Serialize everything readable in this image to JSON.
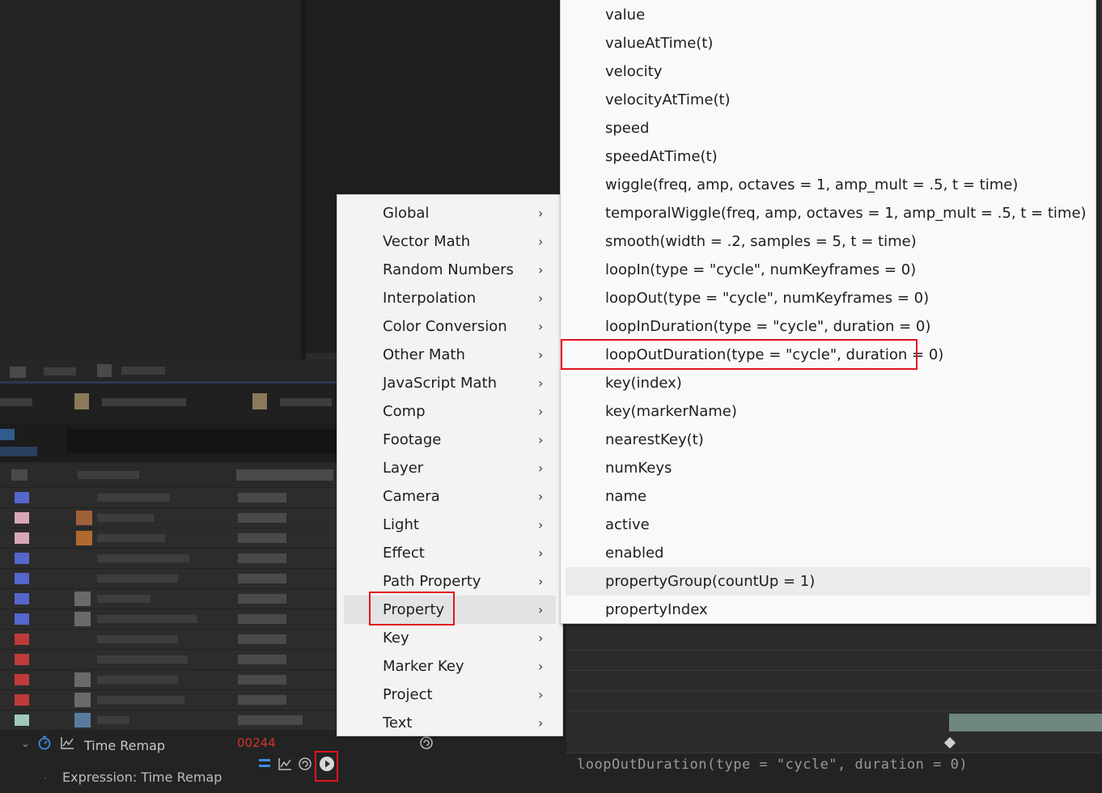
{
  "context_menu": {
    "items": [
      {
        "label": "Global"
      },
      {
        "label": "Vector Math"
      },
      {
        "label": "Random Numbers"
      },
      {
        "label": "Interpolation"
      },
      {
        "label": "Color Conversion"
      },
      {
        "label": "Other Math"
      },
      {
        "label": "JavaScript Math"
      },
      {
        "label": "Comp"
      },
      {
        "label": "Footage"
      },
      {
        "label": "Layer"
      },
      {
        "label": "Camera"
      },
      {
        "label": "Light"
      },
      {
        "label": "Effect"
      },
      {
        "label": "Path Property"
      },
      {
        "label": "Property",
        "highlighted": true
      },
      {
        "label": "Key"
      },
      {
        "label": "Marker Key"
      },
      {
        "label": "Project"
      },
      {
        "label": "Text"
      }
    ],
    "chevron": "›"
  },
  "submenu": {
    "items": [
      {
        "label": "value"
      },
      {
        "label": "valueAtTime(t)"
      },
      {
        "label": "velocity"
      },
      {
        "label": "velocityAtTime(t)"
      },
      {
        "label": "speed"
      },
      {
        "label": "speedAtTime(t)"
      },
      {
        "label": "wiggle(freq, amp, octaves = 1, amp_mult = .5, t = time)"
      },
      {
        "label": "temporalWiggle(freq, amp, octaves = 1, amp_mult = .5, t = time)"
      },
      {
        "label": "smooth(width = .2, samples = 5, t = time)"
      },
      {
        "label": "loopIn(type = \"cycle\", numKeyframes = 0)"
      },
      {
        "label": "loopOut(type = \"cycle\", numKeyframes = 0)"
      },
      {
        "label": "loopInDuration(type = \"cycle\", duration = 0)"
      },
      {
        "label": "loopOutDuration(type = \"cycle\", duration = 0)",
        "outlined": true
      },
      {
        "label": "key(index)"
      },
      {
        "label": "key(markerName)"
      },
      {
        "label": "nearestKey(t)"
      },
      {
        "label": "numKeys"
      },
      {
        "label": "name"
      },
      {
        "label": "active"
      },
      {
        "label": "enabled"
      },
      {
        "label": "propertyGroup(countUp = 1)",
        "hovered": true
      },
      {
        "label": "propertyIndex"
      }
    ]
  },
  "property_row": {
    "label": "Time Remap",
    "value": "00244",
    "expression_label": "Expression: Time Remap"
  },
  "expression_editor": {
    "text": "loopOutDuration(type = \"cycle\", duration = 0)"
  },
  "colors": {
    "accent_red": "#e3141d",
    "value_red": "#d0342c",
    "icon_blue": "#3a8ee6"
  },
  "icons": [
    "stopwatch-icon",
    "graph-icon",
    "spiral-icon",
    "equals-icon",
    "pick-whip-icon",
    "twirl-down-icon",
    "keyframe-icon"
  ]
}
